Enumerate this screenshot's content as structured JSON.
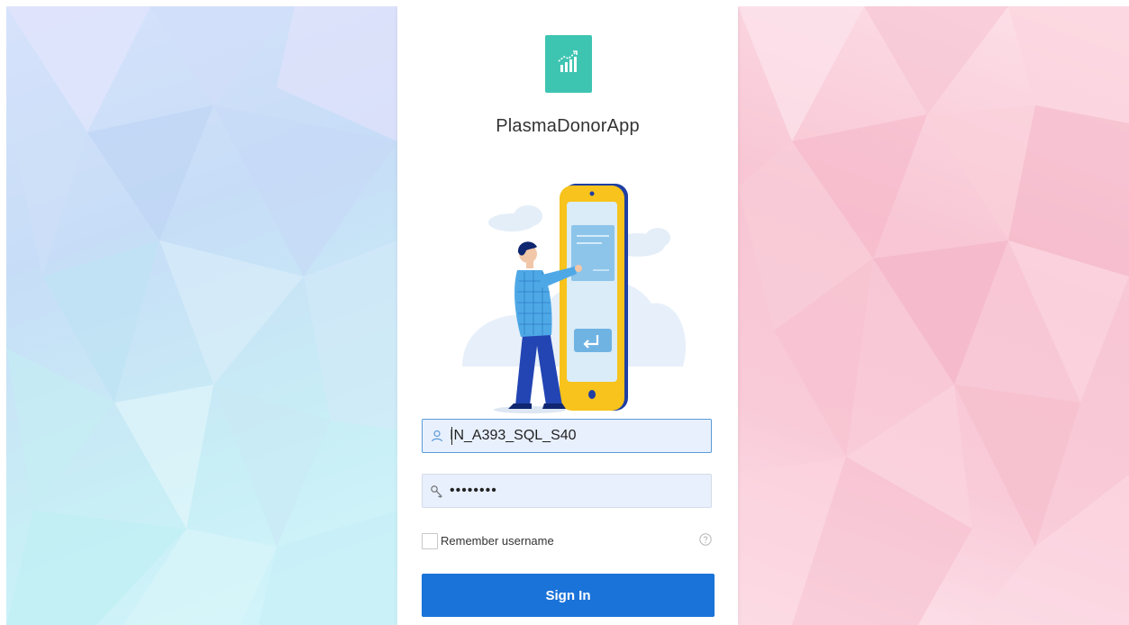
{
  "app": {
    "title": "PlasmaDonorApp",
    "logo_icon": "chart-growth-icon",
    "accent_color": "#3ec5b2"
  },
  "login": {
    "username": {
      "value": "IN_A393_SQL_S40",
      "icon": "user-icon"
    },
    "password": {
      "value": "••••••••",
      "icon": "key-icon"
    },
    "remember_label": "Remember username",
    "remember_checked": false,
    "help_icon": "question-circle-icon",
    "sign_in_label": "Sign In",
    "button_color": "#1a73d9"
  },
  "illustration": {
    "icon": "person-tablet-login-illustration"
  }
}
